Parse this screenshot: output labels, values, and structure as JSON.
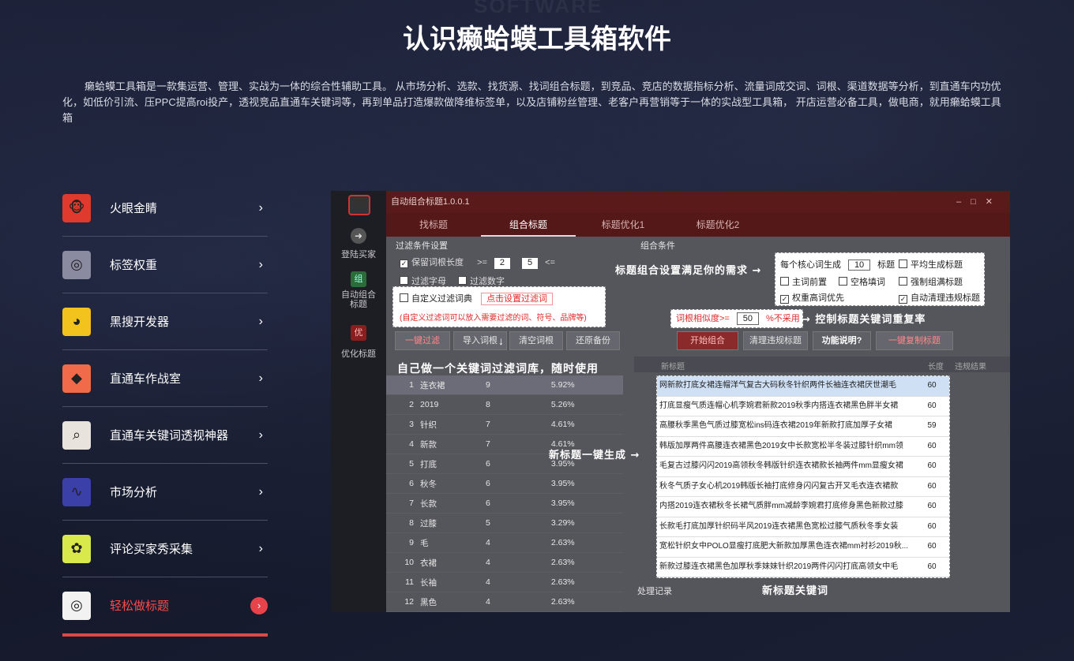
{
  "bg_watermark": "SOFTWARE",
  "title": "认识癞蛤蟆工具箱软件",
  "intro": "癞蛤蟆工具箱是一款集运营、管理、实战为一体的综合性辅助工具。 从市场分析、选款、找货源、找词组合标题，到竞品、竞店的数据指标分析、流量词成交词、词根、渠道数据等分析，到直通车内功优化，如低价引流、压PPC提高roi投产，透视竞品直通车关键词等，再到单品打造爆款做降维标签单，以及店铺粉丝管理、老客户再营销等于一体的实战型工具箱， 开店运营必备工具，做电商，就用癞蛤蟆工具箱",
  "menu": [
    {
      "label": "火眼金睛",
      "icon": "monkey-face-icon",
      "color": "#e03a2e"
    },
    {
      "label": "标签权重",
      "icon": "film-reel-icon",
      "color": "#8a8aa0"
    },
    {
      "label": "黑搜开发器",
      "icon": "ninja-icon",
      "color": "#f2c21d"
    },
    {
      "label": "直通车作战室",
      "icon": "tag-icon",
      "color": "#f16a4a"
    },
    {
      "label": "直通车关键词透视神器",
      "icon": "magnifier-doc-icon",
      "color": "#e8e3dc"
    },
    {
      "label": "市场分析",
      "icon": "trend-chart-icon",
      "color": "#3b3fa8"
    },
    {
      "label": "评论买家秀采集",
      "icon": "flower-icon",
      "color": "#d9e84a"
    },
    {
      "label": "轻松做标题",
      "icon": "target-icon",
      "color": "#f2f2f2",
      "active": true
    }
  ],
  "chevron": "›",
  "app": {
    "window_title": "自动组合标题1.0.0.1",
    "tabs": [
      "找标题",
      "组合标题",
      "标题优化1",
      "标题优化2"
    ],
    "side": [
      "登陆买家",
      "自动组合标题",
      "优化标题"
    ],
    "filter_title": "过滤条件设置",
    "filter_len_label": "保留词根长度",
    "filter_min": "2",
    "filter_max": "5",
    "filter_opt1": "过滤字母",
    "filter_opt2": "过滤数字",
    "custom_filter": "自定义过滤词典",
    "custom_filter_btn": "点击设置过滤词",
    "custom_filter_note": "(自定义过滤词可以放入需要过滤的词、符号、品牌等)",
    "buttons_left": [
      "一键过滤",
      "导入词根",
      "清空词根",
      "还原备份"
    ],
    "combo_title": "组合条件",
    "per_core_label": "每个核心词生成",
    "per_core_value": "10",
    "per_core_unit": "标题",
    "opts": [
      "平均生成标题",
      "主词前置",
      "空格填词",
      "强制组满标题",
      "权重高词优先",
      "自动清理违规标题"
    ],
    "similarity_label": "词根相似度>=",
    "similarity_value": "50",
    "similarity_unit": "%不采用",
    "buttons_right": [
      "开始组合",
      "清理违规标题",
      "功能说明?",
      "一键复制标题"
    ],
    "annotations": {
      "combo": "标题组合设置满足你的需求 →",
      "similar": "→ 控制标题关键词重复率",
      "custom": "自己做一个关键词过滤词库，随时使用",
      "newgen": "新标题一键生成 →",
      "newkw": "新标题关键词"
    },
    "left_table": [
      [
        "1",
        "连衣裙",
        "9",
        "5.92%"
      ],
      [
        "2",
        "2019",
        "8",
        "5.26%"
      ],
      [
        "3",
        "针织",
        "7",
        "4.61%"
      ],
      [
        "4",
        "新款",
        "7",
        "4.61%"
      ],
      [
        "5",
        "打底",
        "6",
        "3.95%"
      ],
      [
        "6",
        "秋冬",
        "6",
        "3.95%"
      ],
      [
        "7",
        "长款",
        "6",
        "3.95%"
      ],
      [
        "8",
        "过膝",
        "5",
        "3.29%"
      ],
      [
        "9",
        "毛",
        "4",
        "2.63%"
      ],
      [
        "10",
        "衣裙",
        "4",
        "2.63%"
      ],
      [
        "11",
        "长袖",
        "4",
        "2.63%"
      ],
      [
        "12",
        "黑色",
        "4",
        "2.63%"
      ]
    ],
    "right_headers": [
      "新标题",
      "长度",
      "违规结果"
    ],
    "titles": [
      [
        "网新款打底女裙连帽洋气复古大码秋冬针织两件长袖连衣裙厌世潮毛",
        "60"
      ],
      [
        "打底显瘦气质连帽心机李婉君新款2019秋季内搭连衣裙黑色胖半女裙",
        "60"
      ],
      [
        "高腰秋季黑色气质过膝宽松ins码连衣裙2019年新款打底加厚子女裙",
        "59"
      ],
      [
        "韩版加厚两件高腰连衣裙黑色2019女中长款宽松半冬装过膝针织mm领",
        "60"
      ],
      [
        "毛复古过膝闪闪2019高领秋冬韩版针织连衣裙款长袖两件mm显瘦女裙",
        "60"
      ],
      [
        "秋冬气质子女心机2019韩版长袖打底修身闪闪复古开叉毛衣连衣裙款",
        "60"
      ],
      [
        "内搭2019连衣裙秋冬长裙气质胖mm减龄李婉君打底修身黑色新款过膝",
        "60"
      ],
      [
        "长款毛打底加厚针织码半风2019连衣裙黑色宽松过膝气质秋冬季女装",
        "60"
      ],
      [
        "宽松针织女中POLO显瘦打底肥大新款加厚黑色连衣裙mm衬衫2019秋...",
        "60"
      ],
      [
        "新款过膝连衣裙黑色加厚秋季妹妹针织2019两件闪闪打底高领女中毛",
        "60"
      ]
    ],
    "log_title": "处理记录"
  }
}
